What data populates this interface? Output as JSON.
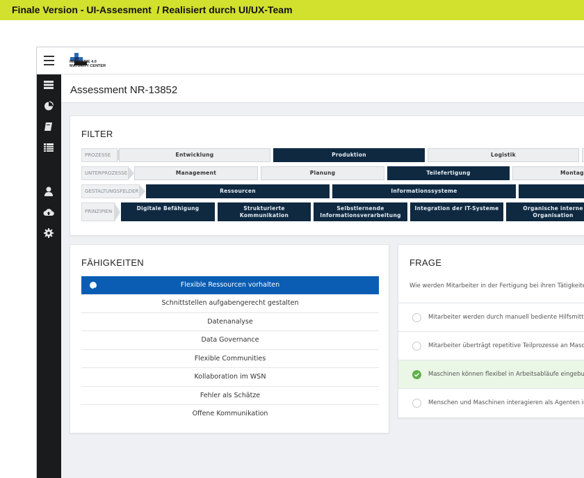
{
  "banner": {
    "text": "Finale Version - UI-Assesment  / Realisiert durch UI/UX-Team"
  },
  "app": {
    "logo_line1": "INDUSTRIE 4.0",
    "logo_line2": "MATURITY CENTER",
    "title": "Assessment NR-13852"
  },
  "sidebar": {
    "icons": [
      "list-icon",
      "pie-chart-icon",
      "book-icon",
      "table-icon",
      "user-icon",
      "cloud-upload-icon",
      "gear-icon"
    ]
  },
  "filter": {
    "title": "FILTER",
    "rows": [
      {
        "label": "PROZESSE",
        "chips": [
          {
            "label": "Entwicklung",
            "active": false
          },
          {
            "label": "Produktion",
            "active": true
          },
          {
            "label": "Logistik",
            "active": false
          }
        ]
      },
      {
        "label": "UNTERPROZESSE",
        "chips": [
          {
            "label": "Management",
            "active": false
          },
          {
            "label": "Planung",
            "active": false
          },
          {
            "label": "Teilefertigung",
            "active": true
          },
          {
            "label": "Montag",
            "active": false
          }
        ]
      },
      {
        "label": "GESTALTUNGSFELDER",
        "chips": [
          {
            "label": "Ressourcen",
            "active": true
          },
          {
            "label": "Informationssysteme",
            "active": true
          },
          {
            "label": "",
            "active": true
          }
        ]
      },
      {
        "label": "PRINZIPIEN",
        "chips": [
          {
            "label": "Digitale Befähigung",
            "active": true
          },
          {
            "label": "Strukturierte Kommunikation",
            "active": true
          },
          {
            "label": "Selbstlernende Informationsverarbeitung",
            "active": true
          },
          {
            "label": "Integration der IT-Systeme",
            "active": true
          },
          {
            "label": "Organische interne Organisation",
            "active": true
          }
        ]
      }
    ]
  },
  "capabilities": {
    "title": "FÄHIGKEITEN",
    "items": [
      "Flexible Ressourcen vorhalten",
      "Schnittstellen aufgabengerecht gestalten",
      "Datenanalyse",
      "Data Governance",
      "Flexible Communities",
      "Kollaboration im WSN",
      "Fehler als Schätze",
      "Offene Kommunikation"
    ],
    "selected_index": 0
  },
  "question": {
    "title": "FRAGE",
    "text": "Wie werden Mitarbeiter in der Fertigung bei ihren Tätigkeiten",
    "answers": [
      "Mitarbeiter werden durch manuell bediente Hilfsmittel",
      "Mitarbeiter überträgt repetitive Teilprozesse an Masch",
      "Maschinen können flexibel in Arbeitsabläufe eingebund",
      "Menschen und Maschinen interagieren als Agenten in"
    ],
    "selected_index": 2
  },
  "colors": {
    "banner": "#d2e02e",
    "sidebar": "#1a1b1d",
    "chip_active": "#0f2941",
    "selection_blue": "#0a5db3",
    "answer_green": "#5fb04a"
  }
}
